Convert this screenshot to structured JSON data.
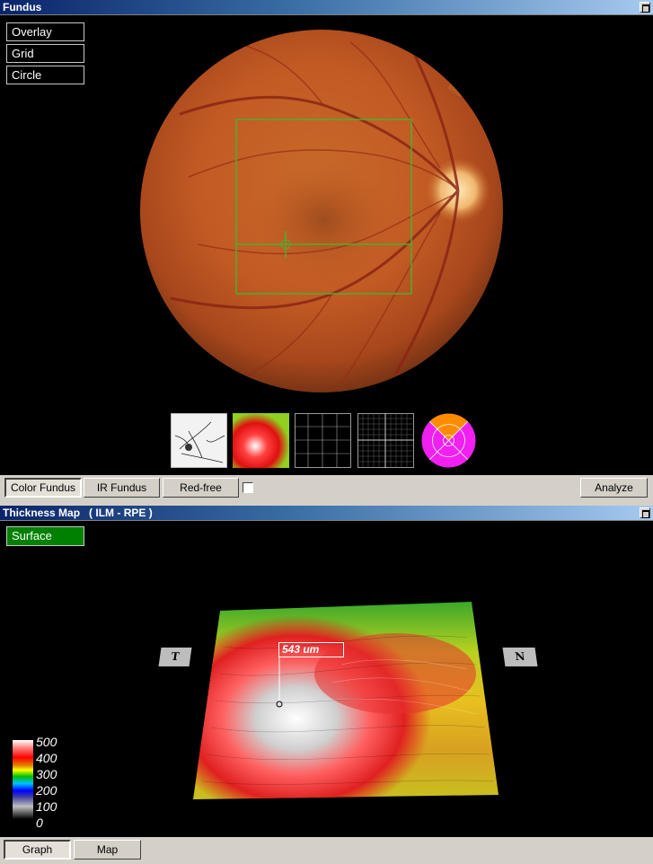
{
  "fundus_panel": {
    "title": "Fundus",
    "overlay_buttons": [
      "Overlay",
      "Grid",
      "Circle"
    ]
  },
  "fundus_toolbar": {
    "color_fundus": "Color Fundus",
    "ir_fundus": "IR Fundus",
    "red_free": "Red-free",
    "analyze": "Analyze"
  },
  "thickness_panel": {
    "title": "Thickness Map",
    "subtitle": "( ILM - RPE )",
    "surface_button": "Surface",
    "left_label": "T",
    "right_label": "N",
    "annotation": "543 um",
    "legend_values": [
      "500",
      "400",
      "300",
      "200",
      "100",
      "0"
    ],
    "colors": {
      "surface_button": "#008000",
      "accent_green": "#4caf2e"
    }
  },
  "bottom_toolbar": {
    "graph": "Graph",
    "map": "Map"
  },
  "thumbnails": [
    {
      "icon": "vessel-map-icon"
    },
    {
      "icon": "thickness-heatmap-icon"
    },
    {
      "icon": "coarse-grid-icon"
    },
    {
      "icon": "fine-grid-icon"
    },
    {
      "icon": "etdrs-sector-icon"
    }
  ]
}
